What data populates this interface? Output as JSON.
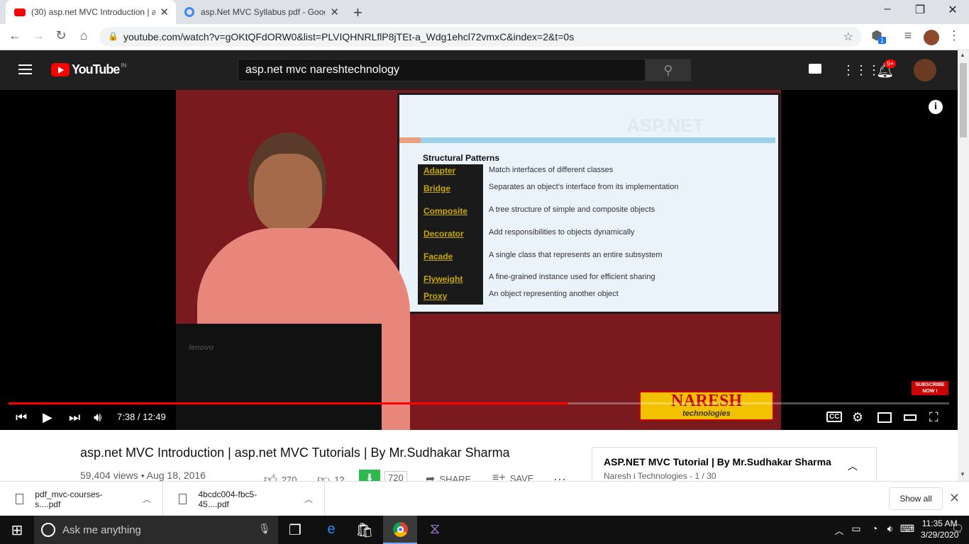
{
  "browser": {
    "tabs": [
      {
        "title": "(30) asp.net MVC Introduction | a",
        "active": true
      },
      {
        "title": "asp.Net MVC Syllabus pdf - Goog",
        "active": false
      }
    ],
    "url": "youtube.com/watch?v=gOKtQFdORW0&list=PLVIQHNRLflP8jTEt-a_Wdg1ehcl72vmxC&index=2&t=0s",
    "extension_badge": "1"
  },
  "youtube": {
    "logo_text": "YouTube",
    "country": "IN",
    "search_value": "asp.net mvc nareshtechnology",
    "notification_count": "9+"
  },
  "video_frame": {
    "slide_title": "Structural Patterns",
    "slide_watermark": "ASP.NET",
    "patterns": [
      {
        "name": "Adapter",
        "desc": "Match interfaces of different classes"
      },
      {
        "name": "Bridge",
        "desc": "Separates an object's interface from its implementation"
      },
      {
        "name": "Composite",
        "desc": "A tree structure of simple and composite objects"
      },
      {
        "name": "Decorator",
        "desc": "Add responsibilities to objects dynamically"
      },
      {
        "name": "Facade",
        "desc": "A single class that represents an entire subsystem"
      },
      {
        "name": "Flyweight",
        "desc": "A fine-grained instance used for efficient sharing"
      },
      {
        "name": "Proxy",
        "desc": "An object representing another object"
      }
    ],
    "laptop_brand": "lenovo",
    "logo_main": "NARESH",
    "logo_sub": "technologies",
    "subscribe_line1": "SUBSCRIBE",
    "subscribe_line2": "NOW !"
  },
  "player": {
    "time": "7:38 / 12:49",
    "progress_fraction": 0.595
  },
  "video": {
    "title": "asp.net MVC Introduction | asp.net MVC Tutorials | By Mr.Sudhakar Sharma",
    "meta": "59,404 views • Aug 18, 2016",
    "likes": "270",
    "dislikes": "12",
    "download_count": "720",
    "share_label": "SHARE",
    "save_label": "SAVE"
  },
  "playlist": {
    "title": "ASP.NET MVC Tutorial | By Mr.Sudhakar Sharma",
    "subtitle": "Naresh i Technologies - 1 / 30"
  },
  "downloads": {
    "items": [
      "pdf_mvc-courses-s....pdf",
      "4bcdc004-fbc5-45....pdf"
    ],
    "show_all": "Show all"
  },
  "taskbar": {
    "search_placeholder": "Ask me anything",
    "time": "11:35 AM",
    "date": "3/29/2020"
  },
  "colors": {
    "accent": "#ff0000",
    "yt_header": "#202020",
    "taskbar": "#101010"
  }
}
